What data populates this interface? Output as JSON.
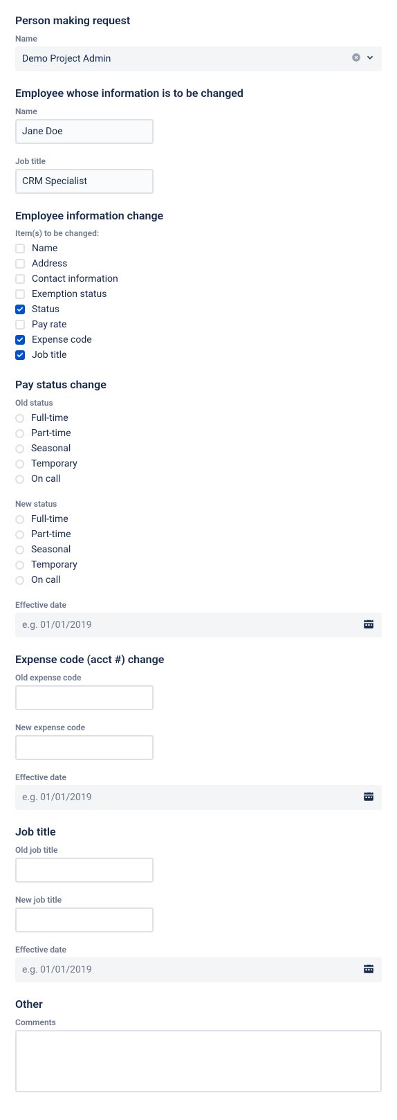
{
  "sections": {
    "requester": {
      "title": "Person making request",
      "name_label": "Name",
      "name_value": "Demo Project Admin"
    },
    "employee": {
      "title": "Employee whose information is to be changed",
      "name_label": "Name",
      "name_value": "Jane Doe",
      "job_label": "Job title",
      "job_value": "CRM Specialist"
    },
    "info_change": {
      "title": "Employee information change",
      "items_label": "Item(s) to be changed:",
      "items": [
        {
          "label": "Name",
          "checked": false
        },
        {
          "label": "Address",
          "checked": false
        },
        {
          "label": "Contact information",
          "checked": false
        },
        {
          "label": "Exemption status",
          "checked": false
        },
        {
          "label": "Status",
          "checked": true
        },
        {
          "label": "Pay rate",
          "checked": false
        },
        {
          "label": "Expense code",
          "checked": true
        },
        {
          "label": "Job title",
          "checked": true
        }
      ]
    },
    "pay_status": {
      "title": "Pay status change",
      "old_label": "Old status",
      "new_label": "New status",
      "options": [
        "Full-time",
        "Part-time",
        "Seasonal",
        "Temporary",
        "On call"
      ],
      "effective_label": "Effective date",
      "effective_placeholder": "e.g. 01/01/2019"
    },
    "expense": {
      "title": "Expense code (acct #) change",
      "old_label": "Old expense code",
      "new_label": "New expense code",
      "effective_label": "Effective date",
      "effective_placeholder": "e.g. 01/01/2019"
    },
    "job_title": {
      "title": "Job title",
      "old_label": "Old job title",
      "new_label": "New job title",
      "effective_label": "Effective date",
      "effective_placeholder": "e.g. 01/01/2019"
    },
    "other": {
      "title": "Other",
      "comments_label": "Comments"
    }
  }
}
